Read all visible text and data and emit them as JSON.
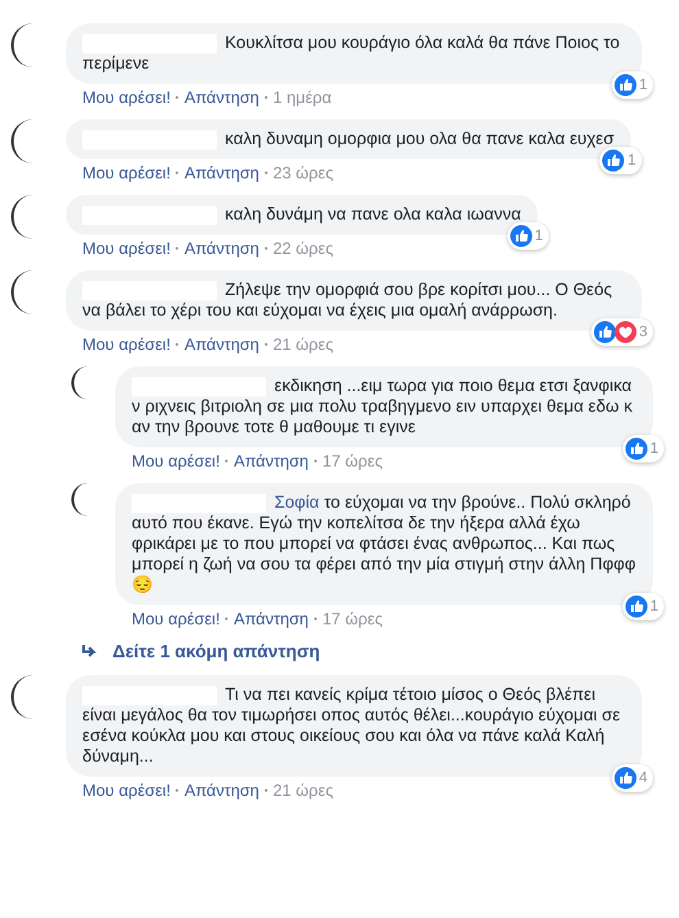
{
  "comments": [
    {
      "reply": false,
      "text": "Κουκλίτσα μου κουράγιο όλα καλά θα πάνε Ποιος το περίμενε",
      "reactions": [
        {
          "kind": "like"
        }
      ],
      "reaction_count": "1",
      "like_label": "Μου αρέσει!",
      "reply_label": "Απάντηση",
      "time": "1 ημέρα"
    },
    {
      "reply": false,
      "text": "καλη δυναμη ομορφια μου ολα θα πανε καλα ευχεσ",
      "reactions": [
        {
          "kind": "like"
        }
      ],
      "reaction_count": "1",
      "like_label": "Μου αρέσει!",
      "reply_label": "Απάντηση",
      "time": "23 ώρες"
    },
    {
      "reply": false,
      "text": "καλη δυνάμη να πανε ολα καλα ιωαννα",
      "reactions": [
        {
          "kind": "like"
        }
      ],
      "reaction_count": "1",
      "like_label": "Μου αρέσει!",
      "reply_label": "Απάντηση",
      "time": "22 ώρες"
    },
    {
      "reply": false,
      "text": "Ζήλεψε την ομορφιά σου βρε κορίτσι μου... Ο Θεός να βάλει το χέρι του και εύχομαι να έχεις μια ομαλή ανάρρωση.",
      "reactions": [
        {
          "kind": "like"
        },
        {
          "kind": "love"
        }
      ],
      "reaction_count": "3",
      "like_label": "Μου αρέσει!",
      "reply_label": "Απάντηση",
      "time": "21 ώρες"
    },
    {
      "reply": true,
      "text": "εκδικηση ...ειμ τωρα για ποιο θεμα ετσι ξανφικα ν ριχνεις βιτριολη σε μια πολυ τραβηγμενο ειν υπαρχει θεμα εδω κ αν την βρουνε τοτε θ μαθουμε τι εγινε",
      "reactions": [
        {
          "kind": "like"
        }
      ],
      "reaction_count": "1",
      "like_label": "Μου αρέσει!",
      "reply_label": "Απάντηση",
      "time": "17 ώρες"
    },
    {
      "reply": true,
      "mention": "Σοφία",
      "text": "το εύχομαι να την βρούνε.. Πολύ σκληρό αυτό που έκανε. Εγώ την κοπελίτσα δε την ήξερα αλλά έχω φρικάρει με το που μπορεί να φτάσει ένας ανθρωπος... Και πως μπορεί η ζωή να σου τα φέρει από την μία στιγμή στην άλλη Πφφφ 😔",
      "reactions": [
        {
          "kind": "like"
        }
      ],
      "reaction_count": "1",
      "like_label": "Μου αρέσει!",
      "reply_label": "Απάντηση",
      "time": "17 ώρες"
    },
    {
      "kind": "more",
      "text": "Δείτε 1 ακόμη απάντηση"
    },
    {
      "reply": false,
      "text": "Τι να πει κανείς κρίμα τέτοιο μίσος ο Θεός βλέπει είναι μεγάλος θα τον τιμωρήσει οπος αυτός θέλει...κουράγιο εύχομαι σε εσένα κούκλα μου και στους οικείους σου και όλα να πάνε καλά Καλή δύναμη...",
      "reactions": [
        {
          "kind": "like"
        }
      ],
      "reaction_count": "4",
      "like_label": "Μου αρέσει!",
      "reply_label": "Απάντηση",
      "time": "21 ώρες"
    }
  ]
}
